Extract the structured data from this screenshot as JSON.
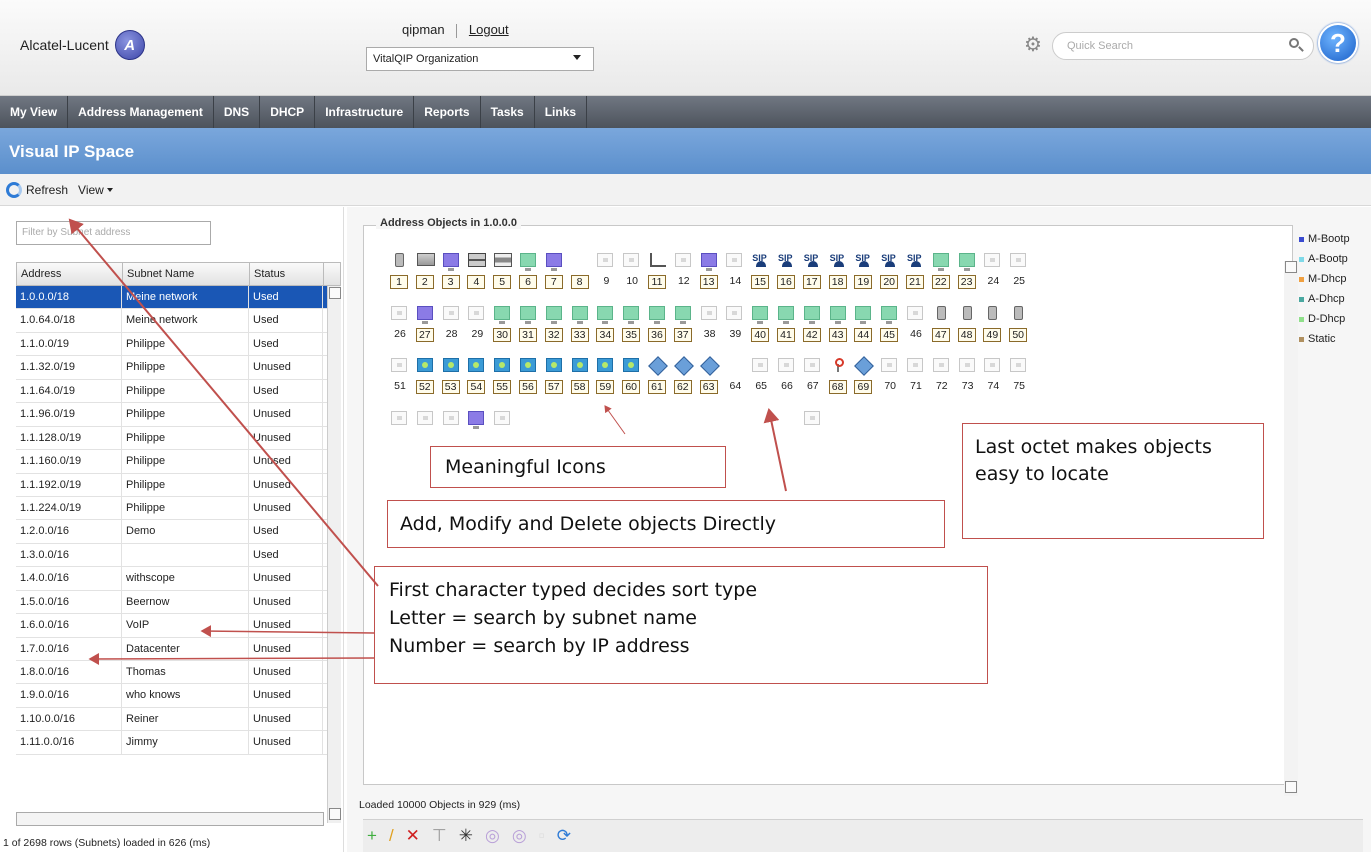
{
  "header": {
    "logo_text": "Alcatel-Lucent",
    "logo_icon": "alcatel-lucent-logo-icon",
    "user": "qipman",
    "logout": "Logout",
    "org": "VitalQIP Organization",
    "search_placeholder": "Quick Search",
    "help": "?"
  },
  "nav": [
    "My View",
    "Address Management",
    "DNS",
    "DHCP",
    "Infrastructure",
    "Reports",
    "Tasks",
    "Links"
  ],
  "title": "Visual IP Space",
  "toolbar": {
    "refresh": "Refresh",
    "view": "View"
  },
  "left": {
    "filter_placeholder": "Filter by Subnet address",
    "columns": [
      "Address",
      "Subnet Name",
      "Status"
    ],
    "rows": [
      [
        "1.0.0.0/18",
        "Meine network",
        "Used"
      ],
      [
        "1.0.64.0/18",
        "Meine network",
        "Used"
      ],
      [
        "1.1.0.0/19",
        "Philippe",
        "Used"
      ],
      [
        "1.1.32.0/19",
        "Philippe",
        "Unused"
      ],
      [
        "1.1.64.0/19",
        "Philippe",
        "Used"
      ],
      [
        "1.1.96.0/19",
        "Philippe",
        "Unused"
      ],
      [
        "1.1.128.0/19",
        "Philippe",
        "Unused"
      ],
      [
        "1.1.160.0/19",
        "Philippe",
        "Unused"
      ],
      [
        "1.1.192.0/19",
        "Philippe",
        "Unused"
      ],
      [
        "1.1.224.0/19",
        "Philippe",
        "Unused"
      ],
      [
        "1.2.0.0/16",
        "Demo",
        "Used"
      ],
      [
        "1.3.0.0/16",
        "",
        "Used"
      ],
      [
        "1.4.0.0/16",
        "withscope",
        "Unused"
      ],
      [
        "1.5.0.0/16",
        "Beernow",
        "Unused"
      ],
      [
        "1.6.0.0/16",
        "VoIP",
        "Unused"
      ],
      [
        "1.7.0.0/16",
        "Datacenter",
        "Unused"
      ],
      [
        "1.8.0.0/16",
        "Thomas",
        "Unused"
      ],
      [
        "1.9.0.0/16",
        "who knows",
        "Unused"
      ],
      [
        "1.10.0.0/16",
        "Reiner",
        "Unused"
      ],
      [
        "1.11.0.0/16",
        "Jimmy",
        "Unused"
      ]
    ],
    "status": "1 of 2698 rows (Subnets) loaded in 626 (ms)"
  },
  "right": {
    "title": "Address Objects in 1.0.0.0",
    "status": "Loaded 10000 Objects in 929 (ms)",
    "legend": [
      {
        "label": "M-Bootp",
        "color": "#3a4bd0"
      },
      {
        "label": "A-Bootp",
        "color": "#7fd9e8"
      },
      {
        "label": "M-Dhcp",
        "color": "#f0a040"
      },
      {
        "label": "A-Dhcp",
        "color": "#4aa8a0"
      },
      {
        "label": "D-Dhcp",
        "color": "#8fe08a"
      },
      {
        "label": "Static",
        "color": "#b09060"
      }
    ],
    "rows": [
      [
        {
          "n": "1",
          "t": "mobile",
          "b": true
        },
        {
          "n": "2",
          "t": "desk",
          "b": true
        },
        {
          "n": "3",
          "t": "mon",
          "b": true
        },
        {
          "n": "4",
          "t": "scanner",
          "b": true
        },
        {
          "n": "5",
          "t": "printer",
          "b": true
        },
        {
          "n": "6",
          "t": "mong",
          "b": true
        },
        {
          "n": "7",
          "t": "mon",
          "b": true
        },
        {
          "n": "8",
          "t": "none",
          "b": true
        },
        {
          "n": "9",
          "t": "empty",
          "b": false
        },
        {
          "n": "10",
          "t": "empty",
          "b": false
        },
        {
          "n": "11",
          "t": "laptop",
          "b": true
        },
        {
          "n": "12",
          "t": "empty",
          "b": false
        },
        {
          "n": "13",
          "t": "mon",
          "b": true
        },
        {
          "n": "14",
          "t": "empty",
          "b": false
        },
        {
          "n": "15",
          "t": "phone",
          "b": true
        },
        {
          "n": "16",
          "t": "phone",
          "b": true
        },
        {
          "n": "17",
          "t": "phone",
          "b": true
        },
        {
          "n": "18",
          "t": "phone",
          "b": true
        },
        {
          "n": "19",
          "t": "phone",
          "b": true
        },
        {
          "n": "20",
          "t": "phone",
          "b": true
        },
        {
          "n": "21",
          "t": "phone",
          "b": true
        },
        {
          "n": "22",
          "t": "mong",
          "b": true
        },
        {
          "n": "23",
          "t": "mong",
          "b": true
        },
        {
          "n": "24",
          "t": "empty",
          "b": false
        },
        {
          "n": "25",
          "t": "empty",
          "b": false
        }
      ],
      [
        {
          "n": "26",
          "t": "empty",
          "b": false
        },
        {
          "n": "27",
          "t": "mon",
          "b": true
        },
        {
          "n": "28",
          "t": "empty",
          "b": false
        },
        {
          "n": "29",
          "t": "empty",
          "b": false
        },
        {
          "n": "30",
          "t": "mong",
          "b": true
        },
        {
          "n": "31",
          "t": "mong",
          "b": true
        },
        {
          "n": "32",
          "t": "mong",
          "b": true
        },
        {
          "n": "33",
          "t": "mong",
          "b": true
        },
        {
          "n": "34",
          "t": "mong",
          "b": true
        },
        {
          "n": "35",
          "t": "mong",
          "b": true
        },
        {
          "n": "36",
          "t": "mong",
          "b": true
        },
        {
          "n": "37",
          "t": "mong",
          "b": true
        },
        {
          "n": "38",
          "t": "empty",
          "b": false
        },
        {
          "n": "39",
          "t": "empty",
          "b": false
        },
        {
          "n": "40",
          "t": "mong",
          "b": true
        },
        {
          "n": "41",
          "t": "mong",
          "b": true
        },
        {
          "n": "42",
          "t": "mong",
          "b": true
        },
        {
          "n": "43",
          "t": "mong",
          "b": true
        },
        {
          "n": "44",
          "t": "mong",
          "b": true
        },
        {
          "n": "45",
          "t": "mong",
          "b": true
        },
        {
          "n": "46",
          "t": "empty",
          "b": false
        },
        {
          "n": "47",
          "t": "mobile",
          "b": true
        },
        {
          "n": "48",
          "t": "mobile",
          "b": true
        },
        {
          "n": "49",
          "t": "mobile",
          "b": true
        },
        {
          "n": "50",
          "t": "mobile",
          "b": true
        }
      ],
      [
        {
          "n": "51",
          "t": "empty",
          "b": false
        },
        {
          "n": "52",
          "t": "dhcpg",
          "b": true
        },
        {
          "n": "53",
          "t": "dhcpg",
          "b": true
        },
        {
          "n": "54",
          "t": "dhcpg",
          "b": true
        },
        {
          "n": "55",
          "t": "dhcpg",
          "b": true
        },
        {
          "n": "56",
          "t": "dhcpg",
          "b": true
        },
        {
          "n": "57",
          "t": "dhcpg",
          "b": true
        },
        {
          "n": "58",
          "t": "dhcpg",
          "b": true
        },
        {
          "n": "59",
          "t": "dhcpg",
          "b": true
        },
        {
          "n": "60",
          "t": "dhcpg",
          "b": true
        },
        {
          "n": "61",
          "t": "dia",
          "b": true
        },
        {
          "n": "62",
          "t": "dia",
          "b": true
        },
        {
          "n": "63",
          "t": "dia",
          "b": true
        },
        {
          "n": "64",
          "t": "none",
          "b": false
        },
        {
          "n": "65",
          "t": "empty",
          "b": false
        },
        {
          "n": "66",
          "t": "empty",
          "b": false
        },
        {
          "n": "67",
          "t": "empty",
          "b": false
        },
        {
          "n": "68",
          "t": "wifi",
          "b": true
        },
        {
          "n": "69",
          "t": "dia",
          "b": true
        },
        {
          "n": "70",
          "t": "empty",
          "b": false
        },
        {
          "n": "71",
          "t": "empty",
          "b": false
        },
        {
          "n": "72",
          "t": "empty",
          "b": false
        },
        {
          "n": "73",
          "t": "empty",
          "b": false
        },
        {
          "n": "74",
          "t": "empty",
          "b": false
        },
        {
          "n": "75",
          "t": "empty",
          "b": false
        }
      ],
      [
        {
          "n": "",
          "t": "empty",
          "b": false
        },
        {
          "n": "",
          "t": "empty",
          "b": false
        },
        {
          "n": "",
          "t": "empty",
          "b": false
        },
        {
          "n": "",
          "t": "mon",
          "b": false
        },
        {
          "n": "",
          "t": "empty",
          "b": false
        },
        {
          "n": "",
          "t": "none",
          "b": false
        },
        {
          "n": "",
          "t": "none",
          "b": false
        },
        {
          "n": "",
          "t": "none",
          "b": false
        },
        {
          "n": "",
          "t": "none",
          "b": false
        },
        {
          "n": "",
          "t": "none",
          "b": false
        },
        {
          "n": "",
          "t": "none",
          "b": false
        },
        {
          "n": "",
          "t": "none",
          "b": false
        },
        {
          "n": "",
          "t": "none",
          "b": false
        },
        {
          "n": "",
          "t": "none",
          "b": false
        },
        {
          "n": "",
          "t": "none",
          "b": false
        },
        {
          "n": "",
          "t": "none",
          "b": false
        },
        {
          "n": "",
          "t": "empty",
          "b": false
        }
      ]
    ],
    "actions": [
      {
        "name": "add-icon",
        "glyph": "+",
        "color": "#3fae3f"
      },
      {
        "name": "modify-icon",
        "glyph": "/",
        "color": "#e0a020"
      },
      {
        "name": "delete-icon",
        "glyph": "✕",
        "color": "#d02020"
      },
      {
        "name": "move-icon",
        "glyph": "⊤",
        "color": "#999"
      },
      {
        "name": "split-icon",
        "glyph": "✳",
        "color": "#333"
      },
      {
        "name": "circle-icon",
        "glyph": "◎",
        "color": "#b9a0d8"
      },
      {
        "name": "circle-icon-2",
        "glyph": "◎",
        "color": "#b9a0d8"
      },
      {
        "name": "blank-icon",
        "glyph": "▫",
        "color": "#ddd"
      },
      {
        "name": "sync-icon",
        "glyph": "⟳",
        "color": "#2e7bd6"
      }
    ]
  },
  "annotations": {
    "meaningful": "Meaningful Icons",
    "add_modify": "Add, Modify and Delete objects Directly",
    "last_octet": "Last octet makes objects easy to locate",
    "first_char": [
      "First character typed decides sort type",
      "Letter = search by subnet name",
      "Number = search by IP address"
    ]
  }
}
